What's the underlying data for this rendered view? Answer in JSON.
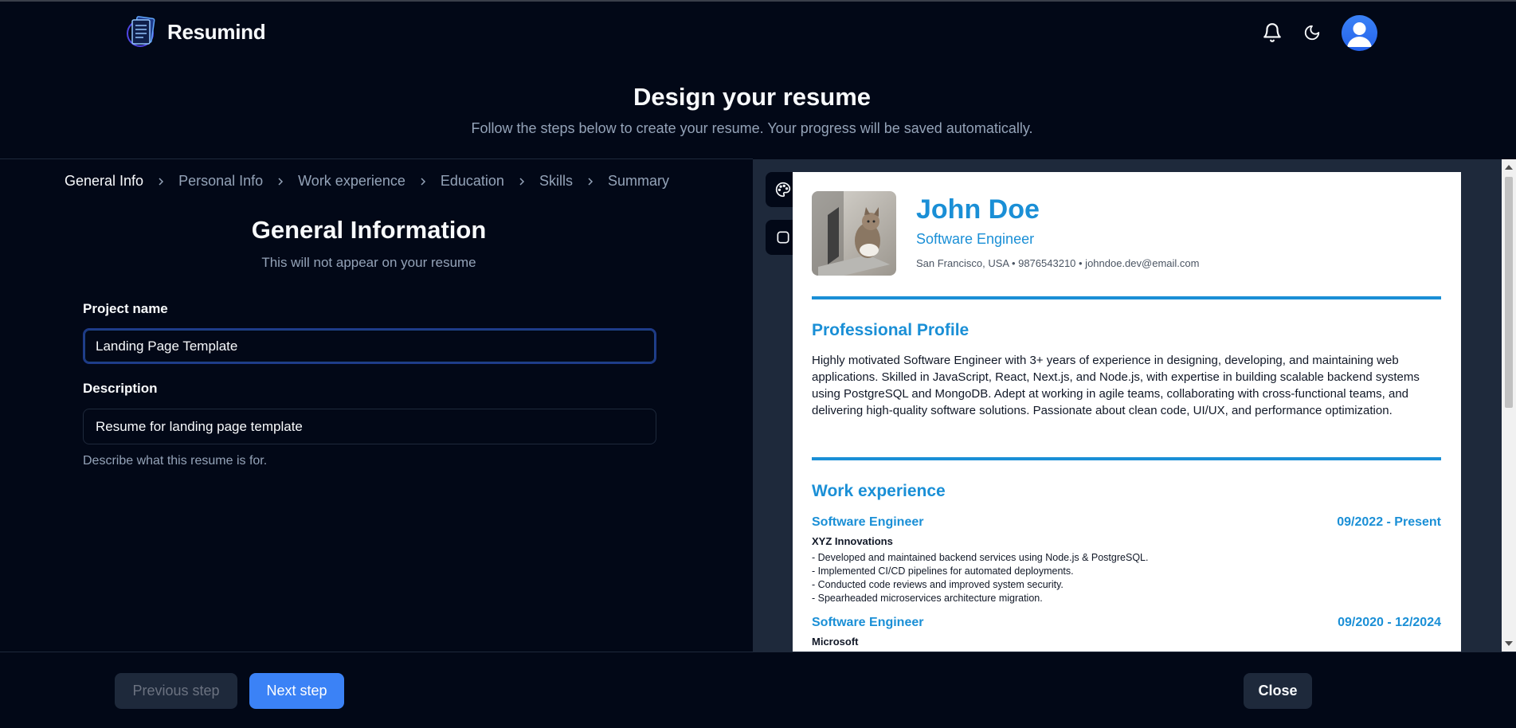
{
  "app": {
    "name": "Resumind"
  },
  "header": {
    "notifications_icon": "bell-icon",
    "theme_icon": "moon-icon",
    "avatar_icon": "user-avatar"
  },
  "page": {
    "title": "Design your resume",
    "subtitle": "Follow the steps below to create your resume. Your progress will be saved automatically."
  },
  "steps": [
    {
      "label": "General Info",
      "active": true
    },
    {
      "label": "Personal Info",
      "active": false
    },
    {
      "label": "Work experience",
      "active": false
    },
    {
      "label": "Education",
      "active": false
    },
    {
      "label": "Skills",
      "active": false
    },
    {
      "label": "Summary",
      "active": false
    }
  ],
  "form": {
    "title": "General Information",
    "subtitle": "This will not appear on your resume",
    "project_name": {
      "label": "Project name",
      "value": "Landing Page Template"
    },
    "description": {
      "label": "Description",
      "value": "Resume for landing page template",
      "hint": "Describe what this resume is for."
    }
  },
  "preview_tools": {
    "palette_icon": "palette-icon",
    "border_style_icon": "square-icon"
  },
  "resume": {
    "name": "John Doe",
    "job_title": "Software Engineer",
    "contact": "San Francisco, USA • 9876543210 • johndoe.dev@email.com",
    "accent_color": "#1a8fd6",
    "profile": {
      "heading": "Professional Profile",
      "text": "Highly motivated Software Engineer with 3+ years of experience in designing, developing, and maintaining web applications. Skilled in JavaScript, React, Next.js, and Node.js, with expertise in building scalable backend systems using PostgreSQL and MongoDB. Adept at working in agile teams, collaborating with cross-functional teams, and delivering high-quality software solutions. Passionate about clean code, UI/UX, and performance optimization."
    },
    "work": {
      "heading": "Work experience",
      "items": [
        {
          "role": "Software Engineer",
          "dates": "09/2022 - Present",
          "company": "XYZ Innovations",
          "bullets": [
            "- Developed and maintained backend services using Node.js & PostgreSQL.",
            "- Implemented CI/CD pipelines for automated deployments.",
            "- Conducted code reviews and improved system security.",
            "- Spearheaded microservices architecture migration."
          ]
        },
        {
          "role": "Software Engineer",
          "dates": "09/2020 - 12/2024",
          "company": "Microsoft",
          "bullets": []
        }
      ]
    }
  },
  "footer": {
    "prev_label": "Previous step",
    "next_label": "Next step",
    "close_label": "Close"
  },
  "colors": {
    "background": "#020817",
    "primary": "#3b82f6",
    "muted": "#94a3b8"
  }
}
